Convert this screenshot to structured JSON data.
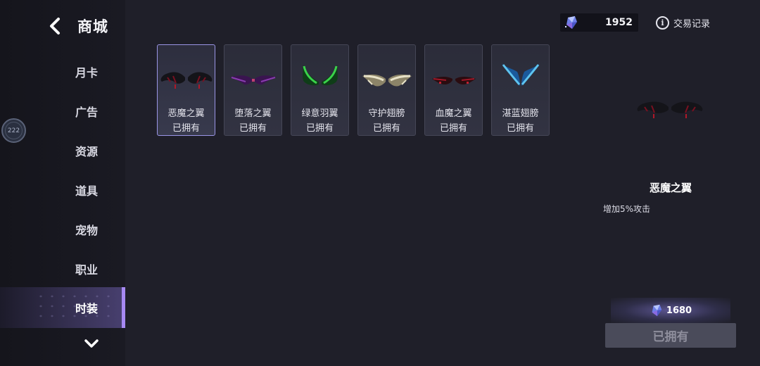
{
  "header": {
    "title": "商城",
    "back_icon": "chevron-left-icon"
  },
  "float_badge": {
    "text": "222"
  },
  "sidebar": {
    "items": [
      {
        "label": "月卡",
        "active": false
      },
      {
        "label": "广告",
        "active": false
      },
      {
        "label": "资源",
        "active": false
      },
      {
        "label": "道具",
        "active": false
      },
      {
        "label": "宠物",
        "active": false
      },
      {
        "label": "职业",
        "active": false
      },
      {
        "label": "时装",
        "active": true
      }
    ],
    "scroll_icon": "chevron-down-icon",
    "accent_color": "#a689f2"
  },
  "currency": {
    "icon": "crystal-gem-icon",
    "value": "1952"
  },
  "trade_record": {
    "icon": "info-icon",
    "label": "交易记录"
  },
  "items": [
    {
      "name": "恶魔之翼",
      "status": "已拥有",
      "selected": true,
      "icon": "demon-wings-icon",
      "colors": [
        "#141419",
        "#7a1020"
      ]
    },
    {
      "name": "堕落之翼",
      "status": "已拥有",
      "selected": false,
      "icon": "fallen-wings-icon",
      "colors": [
        "#3a1450",
        "#8a3cb0"
      ]
    },
    {
      "name": "绿意羽翼",
      "status": "已拥有",
      "selected": false,
      "icon": "green-wings-icon",
      "colors": [
        "#0f3d18",
        "#3ad24a"
      ]
    },
    {
      "name": "守护翅膀",
      "status": "已拥有",
      "selected": false,
      "icon": "guardian-wings-icon",
      "colors": [
        "#8c8468",
        "#e8e2c8"
      ]
    },
    {
      "name": "血魔之翼",
      "status": "已拥有",
      "selected": false,
      "icon": "blood-wings-icon",
      "colors": [
        "#2a0c10",
        "#a01828"
      ]
    },
    {
      "name": "湛蓝翅膀",
      "status": "已拥有",
      "selected": false,
      "icon": "azure-wings-icon",
      "colors": [
        "#1a5a9c",
        "#5ec4f0"
      ]
    }
  ],
  "detail": {
    "name": "恶魔之翼",
    "description": "增加5%攻击",
    "price": "1680",
    "price_icon": "crystal-gem-icon",
    "button_label": "已拥有"
  }
}
